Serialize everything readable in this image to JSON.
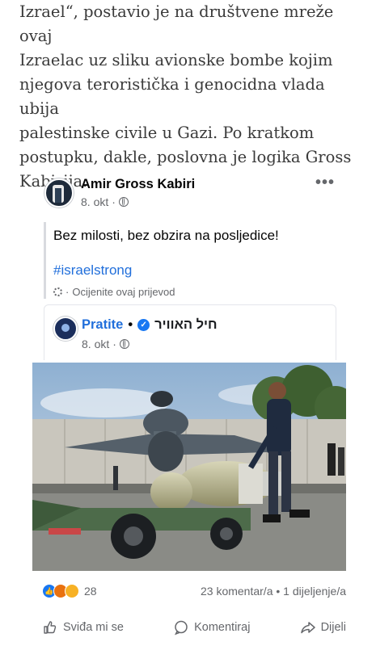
{
  "article": {
    "lines": [
      "Izrael“, postavio je na društvene mreže ovaj",
      "Izraelac uz sliku avionske bombe kojim",
      "njegova teroristička i genocidna vlada ubija",
      "palestinske civile u Gazi. Po kratkom",
      "postupku, dakle, poslovna je logika Gross",
      "Kabirija."
    ]
  },
  "post": {
    "author": "Amir Gross Kabiri",
    "date": "8. okt",
    "separator": "·",
    "more": "•••",
    "text": "Bez milosti, bez obzira na posljedice!",
    "hashtag": "#israelstrong",
    "translate_label": "Ocijenite ovaj prijevod",
    "translate_sep": "·"
  },
  "shared": {
    "follow_label": "Pratite",
    "dot": "•",
    "page_name": "חיל האוויר",
    "date": "8. okt",
    "separator": "·"
  },
  "stats": {
    "reaction_count": "28",
    "comments_shares": "23 komentar/a • 1 dijeljenje/a"
  },
  "actions": {
    "like": "Sviđa mi se",
    "comment": "Komentiraj",
    "share": "Dijeli"
  },
  "colors": {
    "link_blue": "#216fdb",
    "meta_gray": "#65676b",
    "verified_blue": "#1877f2"
  }
}
